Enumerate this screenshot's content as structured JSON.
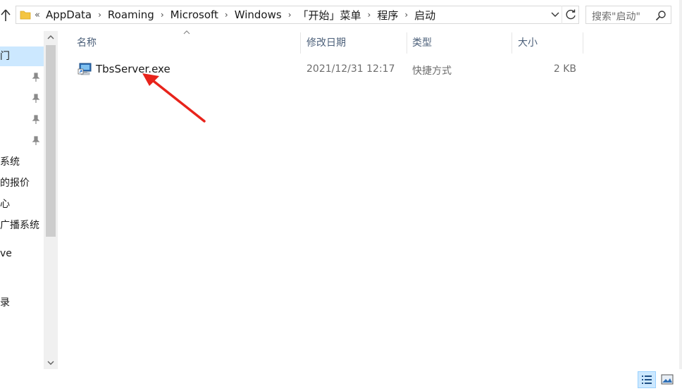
{
  "address": {
    "lead": "«",
    "crumbs": [
      "AppData",
      "Roaming",
      "Microsoft",
      "Windows",
      "「开始」菜单",
      "程序",
      "启动"
    ]
  },
  "search": {
    "placeholder": "搜索\"启动\""
  },
  "nav": {
    "items": [
      "门",
      "",
      "",
      "",
      "",
      "系统",
      "的报价",
      "心",
      "广播系统",
      "",
      "ve",
      "",
      "",
      "录",
      "",
      ""
    ]
  },
  "columns": {
    "name": "名称",
    "date": "修改日期",
    "type": "类型",
    "size": "大小"
  },
  "files": [
    {
      "name": "TbsServer.exe",
      "date": "2021/12/31 12:17",
      "type": "快捷方式",
      "size": "2 KB"
    }
  ],
  "colors": {
    "selection": "#cce8ff",
    "header_text": "#4c607a",
    "annotation": "#e8231b"
  },
  "icons": {
    "up": "arrow-up-icon",
    "folder": "folder-icon",
    "refresh": "refresh-icon",
    "search": "search-icon",
    "file": "shortcut-app-icon",
    "pin": "pin-icon"
  }
}
